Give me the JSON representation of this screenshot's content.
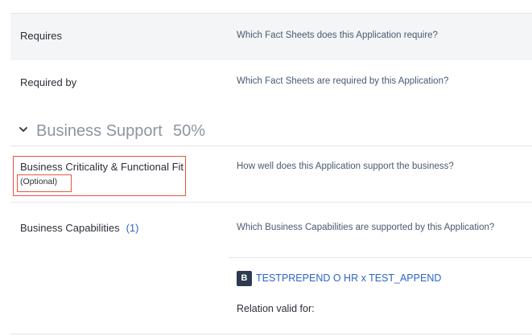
{
  "rows": {
    "requires": {
      "label": "Requires",
      "description": "Which Fact Sheets does this Application require?"
    },
    "required_by": {
      "label": "Required by",
      "description": "Which Fact Sheets are required by this Application?"
    }
  },
  "section": {
    "icon": "chevron-down-icon",
    "title": "Business Support",
    "percent": "50%"
  },
  "business_criticality": {
    "label": "Business Criticality & Functional Fit",
    "optional": "(Optional)",
    "description": "How well does this Application support the business?",
    "highlight_color": "#e8553f"
  },
  "business_capabilities": {
    "label": "Business Capabilities",
    "count": "(1)",
    "description": "Which Business Capabilities are supported by this Application?",
    "relation": {
      "badge": "B",
      "name": "TESTPREPEND O HR x TEST_APPEND",
      "valid_for_label": "Relation valid for:"
    }
  },
  "colors": {
    "link": "#2b66c9",
    "badge_bg": "#2d3a4f",
    "section_title": "#8c95a1"
  }
}
